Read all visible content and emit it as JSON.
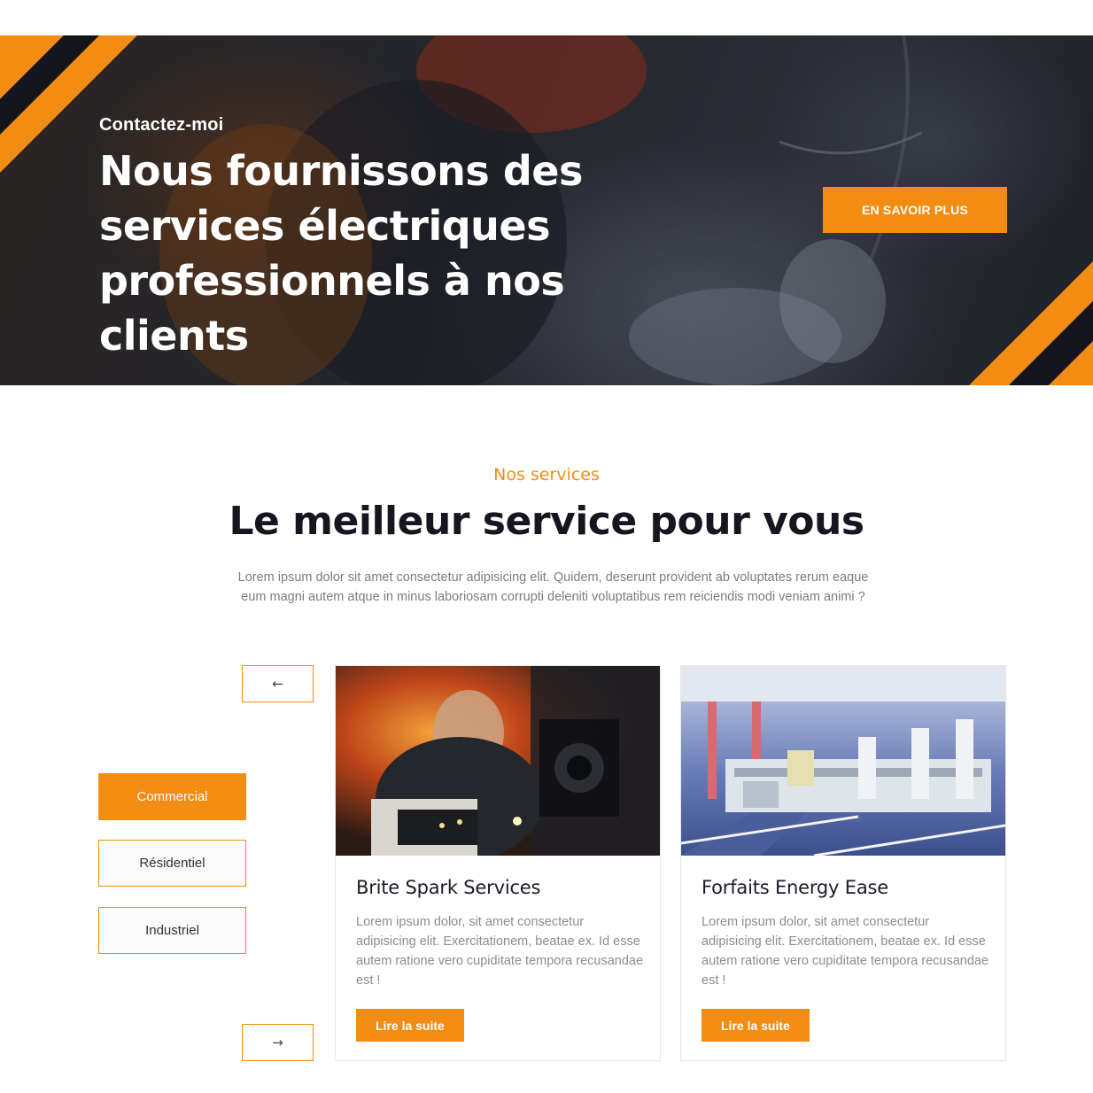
{
  "hero": {
    "eyebrow": "Contactez-moi",
    "title_line1": "Nous fournissons des",
    "title_line2": "services électriques",
    "title_line3": "professionnels à nos clients",
    "cta_label": "EN SAVOIR PLUS"
  },
  "services": {
    "eyebrow": "Nos services",
    "title": "Le meilleur service pour vous",
    "description": "Lorem ipsum dolor sit amet consectetur adipisicing elit. Quidem, deserunt provident ab voluptates rerum eaque eum magni autem atque in minus laboriosam corrupti deleniti voluptatibus rem reiciendis modi veniam animi ?",
    "prev_arrow": "←",
    "next_arrow": "→",
    "categories": [
      {
        "label": "Commercial",
        "active": true
      },
      {
        "label": "Résidentiel",
        "active": false
      },
      {
        "label": "Industriel",
        "active": false
      }
    ],
    "cards": [
      {
        "title": "Brite Spark Services",
        "text": "Lorem ipsum dolor, sit amet consectetur adipisicing elit. Exercitationem, beatae ex. Id esse autem ratione vero cupiditate tempora recusandae est !",
        "button": "Lire la suite"
      },
      {
        "title": "Forfaits Energy Ease",
        "text": "Lorem ipsum dolor, sit amet consectetur adipisicing elit. Exercitationem, beatae ex. Id esse autem ratione vero cupiditate tempora recusandae est !",
        "button": "Lire la suite"
      }
    ]
  },
  "colors": {
    "accent": "#f28c12",
    "dark": "#15161f",
    "muted_text": "#7a7c85"
  }
}
